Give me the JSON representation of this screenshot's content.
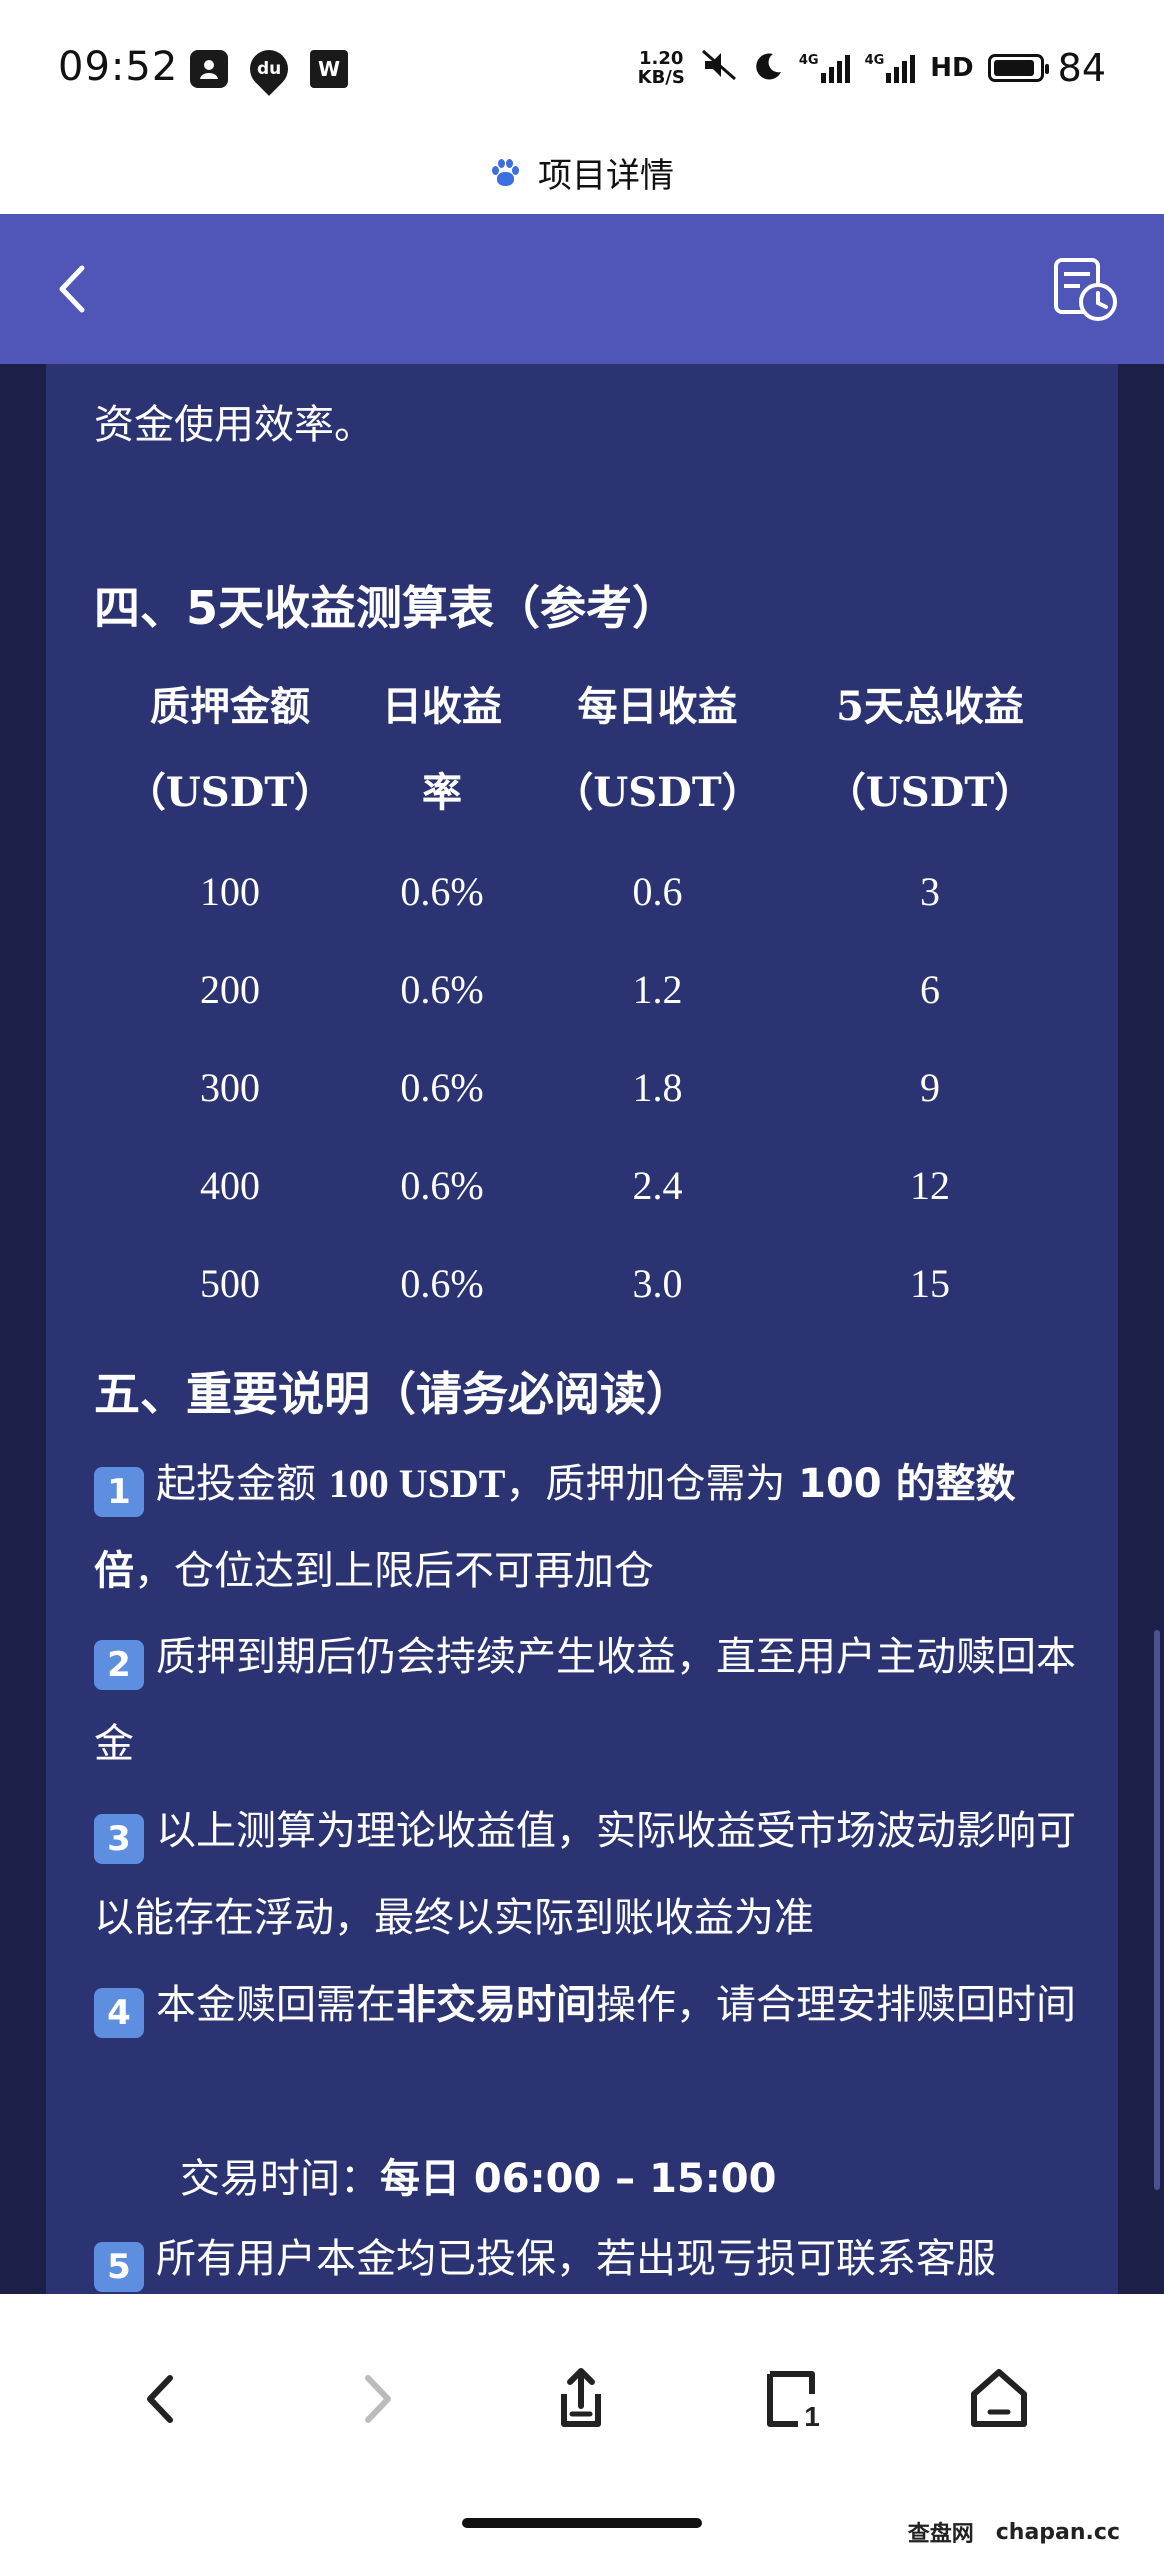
{
  "status_bar": {
    "time": "09:52",
    "notification_icons": [
      "portrait-icon",
      "du-icon",
      "w-icon"
    ],
    "du_label": "du",
    "w_label": "W",
    "net_speed_value": "1.20",
    "net_speed_unit": "KB/S",
    "signal1": "4G",
    "signal2": "4G",
    "hd_label": "HD",
    "battery": "84"
  },
  "browser": {
    "title": "项目详情"
  },
  "content": {
    "intro_tail": "资金使用效率。",
    "section4_title": "四、5天收益测算表（参考）",
    "table": {
      "headers": [
        [
          "质押金额",
          "（USDT）"
        ],
        [
          "日收益",
          "率"
        ],
        [
          "每日收益",
          "（USDT）"
        ],
        [
          "5天总收益",
          "（USDT）"
        ]
      ],
      "rows": [
        [
          "100",
          "0.6%",
          "0.6",
          "3"
        ],
        [
          "200",
          "0.6%",
          "1.2",
          "6"
        ],
        [
          "300",
          "0.6%",
          "1.8",
          "9"
        ],
        [
          "400",
          "0.6%",
          "2.4",
          "12"
        ],
        [
          "500",
          "0.6%",
          "3.0",
          "15"
        ]
      ]
    },
    "section5_title": "五、重要说明（请务必阅读）",
    "notes": {
      "n1": {
        "badge": "1",
        "a": "起投金额 ",
        "b1": "100 USDT",
        "c": "，质押加仓需为 ",
        "b2": "100 的整数倍",
        "d": "，仓位达到上限后不可再加仓"
      },
      "n2": {
        "badge": "2",
        "text": "质押到期后仍会持续产生收益，直至用户主动赎回本金"
      },
      "n3": {
        "badge": "3",
        "text": "以上测算为理论收益值，实际收益受市场波动影响可以能存在浮动，最终以实际到账收益为准"
      },
      "n4": {
        "badge": "4",
        "a": "本金赎回需在",
        "b": "非交易时间",
        "c": "操作，请合理安排赎回时间"
      },
      "trading_label": "交易时间：",
      "trading_value": "每日 06:00 – 15:00",
      "n5": {
        "badge": "5",
        "text": "所有用户本金均已投保，若出现亏损可联系客服"
      }
    }
  },
  "bottom_nav": {
    "items": [
      "back-icon",
      "forward-icon",
      "share-icon",
      "tabs-icon",
      "home-icon"
    ],
    "tabs_count": "1"
  },
  "watermark": {
    "brand": "查盘网",
    "domain": "chapan.cc"
  }
}
